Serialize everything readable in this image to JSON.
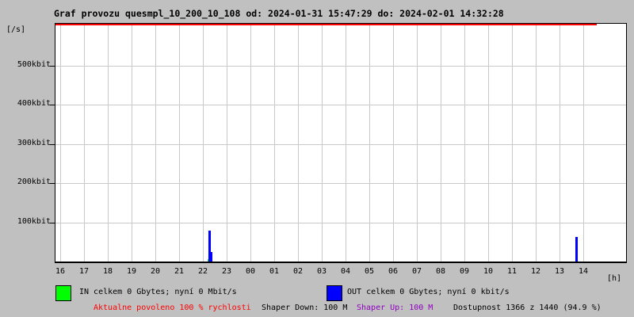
{
  "title": "Graf provozu quesmpl_10_200_10_108 od: 2024-01-31 15:47:29 do: 2024-02-01 14:32:28",
  "y_axis_unit": "[/s]",
  "x_axis_unit": "[h]",
  "legend": {
    "in": {
      "label": "IN celkem 0 Gbytes; nyní 0 Mbit/s",
      "color": "#00ff00"
    },
    "out": {
      "label": "OUT celkem 0 Gbytes; nyní 0 kbit/s",
      "color": "#0000ff"
    }
  },
  "status": {
    "allowed": {
      "text": "Aktualne povoleno 100 % rychlosti",
      "color": "#ff0000"
    },
    "shaper_down": {
      "text": "Shaper Down: 100 M",
      "color": "#000000"
    },
    "shaper_up": {
      "text": "Shaper Up: 100 M",
      "color": "#9000c0"
    },
    "availability": {
      "text": "Dostupnost 1366 z 1440 (94.9 %)",
      "color": "#000000"
    }
  },
  "colors": {
    "page_background": "#c0c0c0",
    "plot_background": "#ffffff",
    "grid": "#c9c9c9",
    "border": "#000000",
    "allowed_line": "#ff0000"
  },
  "chart_data": {
    "type": "bar",
    "title": "Graf provozu quesmpl_10_200_10_108",
    "time_from": "2024-01-31 15:47:29",
    "time_to": "2024-02-01 14:32:28",
    "xlabel": "[h]",
    "ylabel": "[/s]",
    "grid": true,
    "legend_position": "bottom",
    "ylim_kbit": [
      0,
      606
    ],
    "x_ticks": [
      "16",
      "17",
      "18",
      "19",
      "20",
      "21",
      "22",
      "23",
      "00",
      "01",
      "02",
      "03",
      "04",
      "05",
      "06",
      "07",
      "08",
      "09",
      "10",
      "11",
      "12",
      "13",
      "14"
    ],
    "y_ticks": [
      {
        "kbit": 100,
        "label": "100kbit"
      },
      {
        "kbit": 200,
        "label": "200kbit"
      },
      {
        "kbit": 300,
        "label": "300kbit"
      },
      {
        "kbit": 400,
        "label": "400kbit"
      },
      {
        "kbit": 500,
        "label": "500kbit"
      }
    ],
    "series": [
      {
        "name": "IN",
        "color": "#00ff00",
        "bars": [
          {
            "time": "22:09",
            "t_h": 6.2,
            "kbit": 6,
            "w": 2
          }
        ]
      },
      {
        "name": "OUT",
        "color": "#0000ff",
        "bars": [
          {
            "time": "22:14",
            "t_h": 6.23,
            "kbit": 79,
            "w": 3
          },
          {
            "time": "22:20",
            "t_h": 6.33,
            "kbit": 24,
            "w": 2
          },
          {
            "time": "13:40",
            "t_h": 21.67,
            "kbit": 63,
            "w": 3
          }
        ]
      }
    ],
    "allowed_speed_line": {
      "color": "#ff0000",
      "to_t_h": 22.57,
      "ends_at": "14:32"
    }
  }
}
